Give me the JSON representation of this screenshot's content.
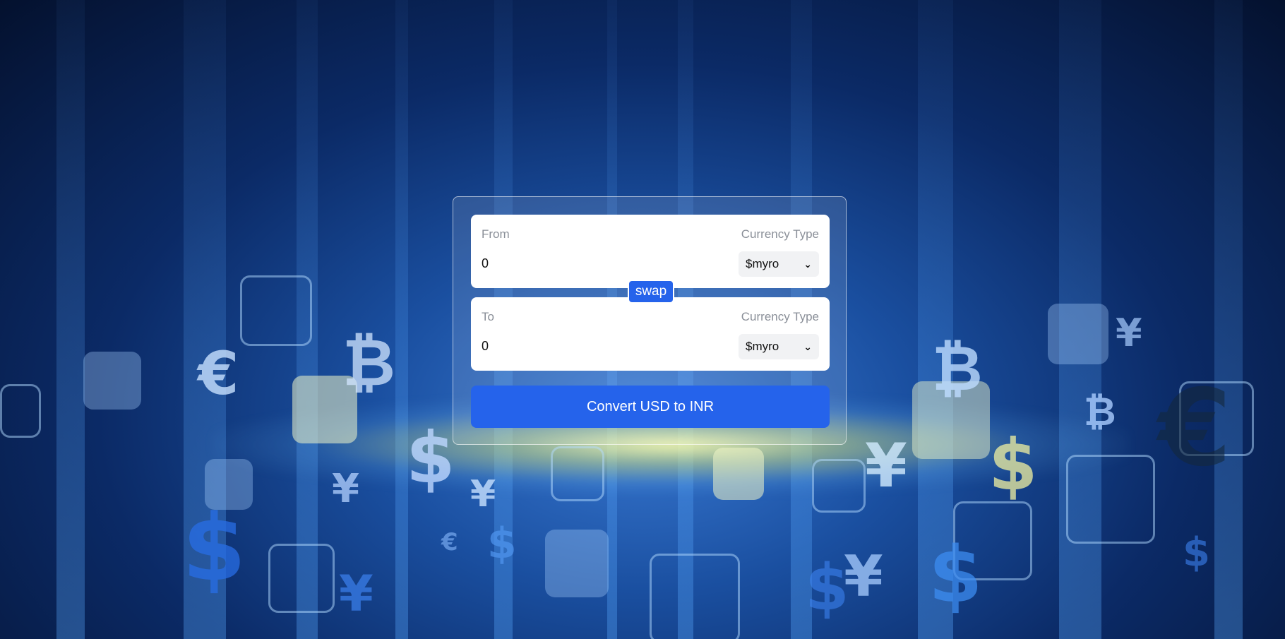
{
  "converter": {
    "from": {
      "label": "From",
      "currency_label": "Currency Type",
      "amount": "0",
      "currency": "$myro"
    },
    "swap_label": "swap",
    "to": {
      "label": "To",
      "currency_label": "Currency Type",
      "amount": "0",
      "currency": "$myro"
    },
    "convert_label": "Convert USD to INR"
  },
  "background": {
    "description_icons": [
      "euro-symbol",
      "bitcoin-symbol",
      "dollar-symbol",
      "yen-symbol"
    ],
    "symbols": [
      "€",
      "₿",
      "$",
      "¥",
      "¥",
      "$",
      "¥",
      "$",
      "€",
      "$",
      "¥",
      "$",
      "₿",
      "¥",
      "₿",
      "$",
      "€",
      "¥",
      "$"
    ],
    "colors": {
      "accent": "#2563eb",
      "glow": "#f5f59a"
    }
  }
}
